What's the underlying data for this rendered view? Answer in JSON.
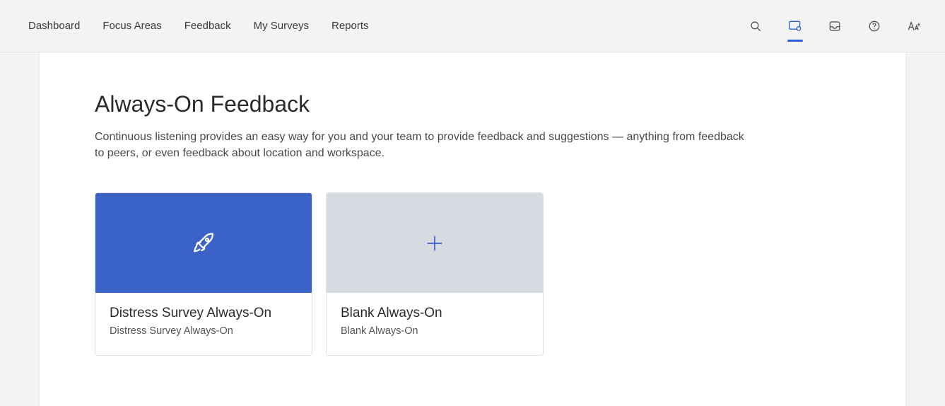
{
  "nav": {
    "items": [
      {
        "label": "Dashboard"
      },
      {
        "label": "Focus Areas"
      },
      {
        "label": "Feedback"
      },
      {
        "label": "My Surveys"
      },
      {
        "label": "Reports"
      }
    ]
  },
  "toolbar": {
    "search": "Search",
    "active_tool": "always-on-feedback",
    "inbox": "Inbox",
    "help": "Help",
    "language": "Language / Accessibility"
  },
  "page": {
    "title": "Always-On Feedback",
    "description": "Continuous listening provides an easy way for you and your team to provide feedback and suggestions — anything from feedback to peers, or even feedback about location and workspace."
  },
  "cards": [
    {
      "icon": "rocket-icon",
      "cover_color": "blue",
      "title": "Distress Survey Always-On",
      "subtitle": "Distress Survey Always-On"
    },
    {
      "icon": "plus-icon",
      "cover_color": "grey",
      "title": "Blank Always-On",
      "subtitle": "Blank Always-On"
    }
  ]
}
